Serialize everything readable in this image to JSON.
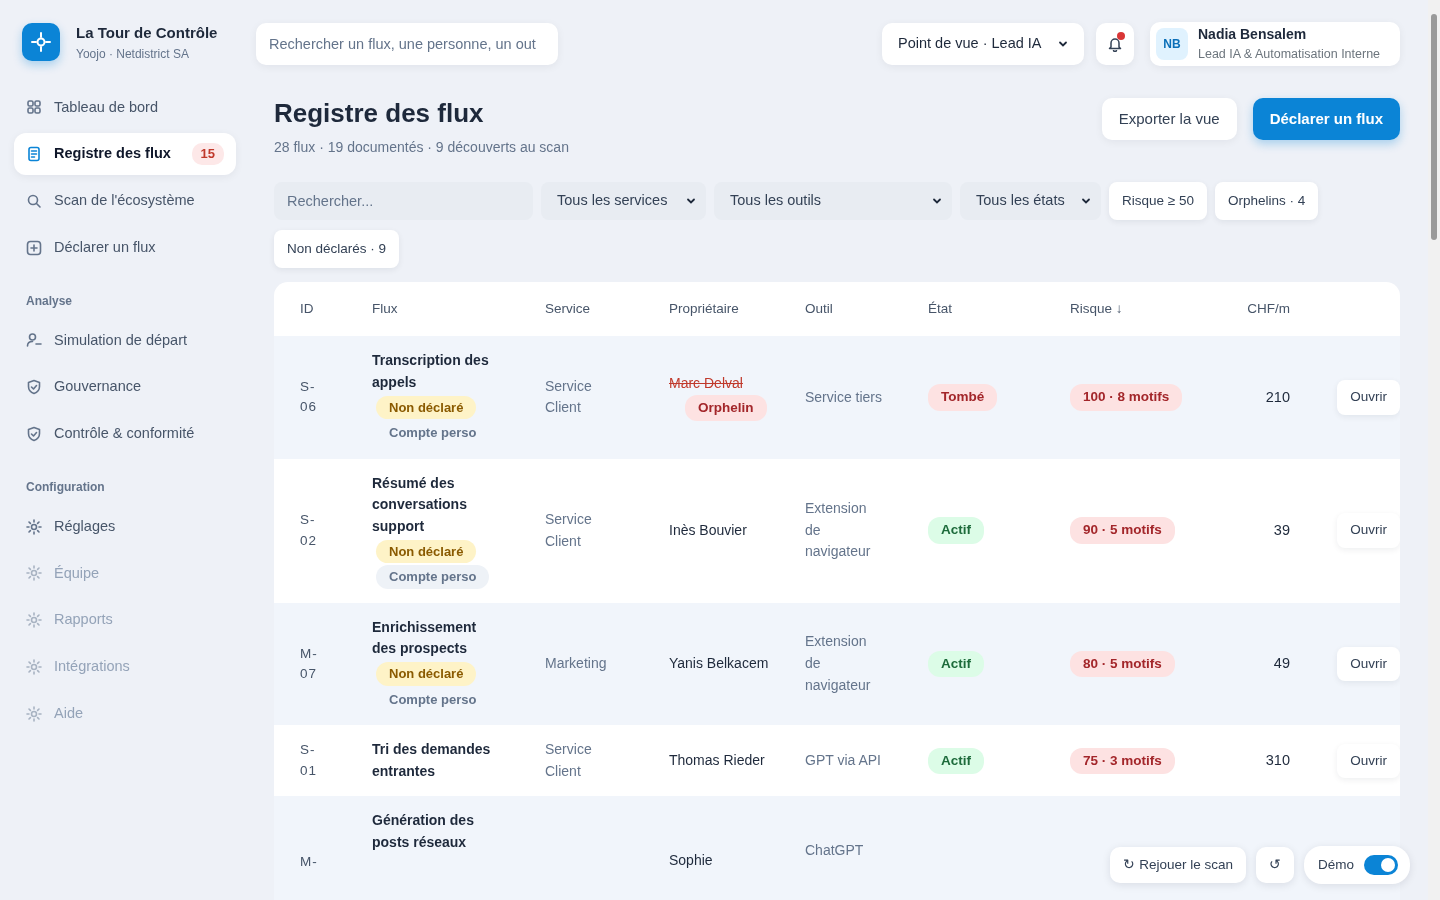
{
  "brand": {
    "title": "La Tour de Contrôle",
    "subtitle": "Yoojo · Netdistrict SA"
  },
  "sidebar": {
    "groups": [
      {
        "items": [
          {
            "label": "Tableau de bord",
            "selected": false,
            "disabled": false
          },
          {
            "label": "Registre des flux",
            "selected": true,
            "disabled": false,
            "badge": "15"
          },
          {
            "label": "Scan de l'écosystème",
            "selected": false,
            "disabled": false
          },
          {
            "label": "Déclarer un flux",
            "selected": false,
            "disabled": false
          }
        ]
      },
      {
        "heading": "Analyse",
        "items": [
          {
            "label": "Simulation de départ",
            "selected": false,
            "disabled": false
          },
          {
            "label": "Gouvernance",
            "selected": false,
            "disabled": false
          },
          {
            "label": "Contrôle & conformité",
            "selected": false,
            "disabled": false
          }
        ]
      },
      {
        "heading": "Configuration",
        "items": [
          {
            "label": "Réglages",
            "selected": false,
            "disabled": false
          },
          {
            "label": "Équipe",
            "selected": false,
            "disabled": true
          },
          {
            "label": "Rapports",
            "selected": false,
            "disabled": true
          },
          {
            "label": "Intégrations",
            "selected": false,
            "disabled": true
          },
          {
            "label": "Aide",
            "selected": false,
            "disabled": true
          }
        ]
      }
    ]
  },
  "topbar": {
    "search": {
      "placeholder": "Rechercher un flux, une personne, un out"
    },
    "viewpoint": "Point de vue · Lead IA",
    "notifications_unread": true,
    "user": {
      "initials": "NB",
      "name": "Nadia Bensalem",
      "role": "Lead IA & Automatisation Interne"
    }
  },
  "page": {
    "title": "Registre des flux",
    "subtitle": "28 flux · 19 documentés · 9 découverts au scan",
    "buttons": [
      {
        "label": "Exporter la vue",
        "kind": "secondary"
      },
      {
        "label": "Déclarer un flux",
        "kind": "primary"
      }
    ]
  },
  "filters": [
    {
      "kind": "search",
      "placeholder": "Rechercher..."
    },
    {
      "kind": "select",
      "label": "Tous les services"
    },
    {
      "kind": "select",
      "label": "Tous les outils"
    },
    {
      "kind": "select",
      "label": "Tous les états"
    },
    {
      "kind": "chip",
      "label": "Risque ≥ 50"
    },
    {
      "kind": "chip",
      "label": "Orphelins · 4"
    },
    {
      "kind": "chip",
      "label": "Non déclarés · 9"
    }
  ],
  "table": {
    "columns": [
      "ID",
      "Flux",
      "Service",
      "Propriétaire",
      "Outil",
      "État",
      "Risque ↓",
      "CHF/m"
    ],
    "rows": [
      {
        "id": "S-06",
        "flux": "Transcription des appels",
        "tags": [
          {
            "label": "Non déclaré",
            "kind": "warning"
          },
          {
            "label": "Compte perso",
            "kind": "plain"
          }
        ],
        "service": "Service Client",
        "owner": "Marc Delval",
        "owner_departed": true,
        "owner_badge": "Orphelin",
        "tool": "Service tiers",
        "state": {
          "label": "Tombé",
          "kind": "danger"
        },
        "risk": "100 · 8 motifs",
        "cost": "210",
        "action": "Ouvrir"
      },
      {
        "id": "S-02",
        "flux": "Résumé des conversations support",
        "tags": [
          {
            "label": "Non déclaré",
            "kind": "warning"
          },
          {
            "label": "Compte perso",
            "kind": "plain"
          }
        ],
        "service": "Service Client",
        "owner": "Inès Bouvier",
        "owner_departed": false,
        "tool": "Extension de navigateur",
        "state": {
          "label": "Actif",
          "kind": "success"
        },
        "risk": "90 · 5 motifs",
        "cost": "39",
        "action": "Ouvrir"
      },
      {
        "id": "M-07",
        "flux": "Enrichissement des prospects",
        "tags": [
          {
            "label": "Non déclaré",
            "kind": "warning"
          },
          {
            "label": "Compte perso",
            "kind": "plain"
          }
        ],
        "service": "Marketing",
        "owner": "Yanis Belkacem",
        "owner_departed": false,
        "tool": "Extension de navigateur",
        "state": {
          "label": "Actif",
          "kind": "success"
        },
        "risk": "80 · 5 motifs",
        "cost": "49",
        "action": "Ouvrir"
      },
      {
        "id": "S-01",
        "flux": "Tri des demandes entrantes",
        "tags": [],
        "service": "Service Client",
        "owner": "Thomas Rieder",
        "owner_departed": false,
        "tool": "GPT via API",
        "state": {
          "label": "Actif",
          "kind": "success"
        },
        "risk": "75 · 3 motifs",
        "cost": "310",
        "action": "Ouvrir"
      },
      {
        "id": "M-",
        "flux": "Génération des posts réseaux",
        "tags": [],
        "owner": "Sophie",
        "tool": "ChatGPT"
      }
    ]
  },
  "floating_bar": {
    "replay": "↻ Rejouer le scan",
    "reset": "↺",
    "demo": {
      "label": "Démo",
      "on": true
    }
  }
}
